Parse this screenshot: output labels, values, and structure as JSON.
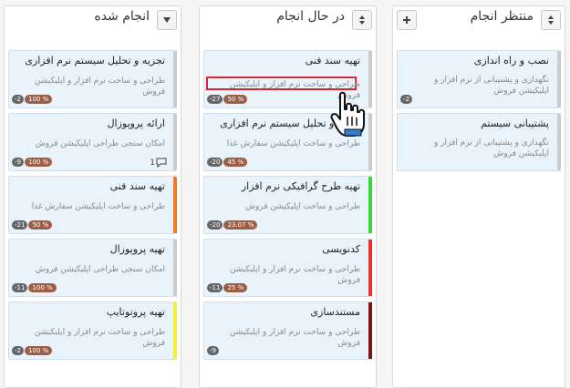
{
  "columns": {
    "done": {
      "title": "انجام شده",
      "header_icon": "filter-icon",
      "cards": [
        {
          "title": "تجزیه و تحلیل سیستم نرم افزاری",
          "subtitle": "طراحی و ساخت نرم افزار و اپلیکیشن فروش",
          "num": "-2",
          "pct": "100 %",
          "color": "#cccccc"
        },
        {
          "title": "ارائه پروپوزال",
          "subtitle": "امکان سنجی طراحی اپلیکیشن فروش",
          "num": "-9",
          "pct": "100 %",
          "comments": "1",
          "color": "#cccccc"
        },
        {
          "title": "تهیه سند فنی",
          "subtitle": "طراحی و ساخت اپلیکیشن سفارش غذا",
          "num": "-21",
          "pct": "50 %",
          "color": "#f07a2a"
        },
        {
          "title": "تهیه پروپوزال",
          "subtitle": "امکان سنجی طراحی اپلیکیشن فروش",
          "num": "-11",
          "pct": "100 %",
          "color": "#cccccc"
        },
        {
          "title": "تهیه پروتوتایپ",
          "subtitle": "طراحی و ساخت نرم افزار و اپلیکیشن فروش",
          "num": "-2",
          "pct": "100 %",
          "color": "#f2f03a"
        }
      ]
    },
    "inprogress": {
      "title": "در حال انجام",
      "header_icon": "sort-icon",
      "cards": [
        {
          "title": "تهیه سند فنی",
          "subtitle": "طراحی و ساخت نرم افزار و اپلیکیشن فروش",
          "num": "-27",
          "pct": "50 %",
          "color": "#cccccc"
        },
        {
          "title": "تجزیه و تحلیل سیستم نرم افزاری",
          "subtitle": "طراحی و ساخت اپلیکیشن سفارش غذا",
          "num": "-20",
          "pct": "45 %",
          "color": "#cccccc"
        },
        {
          "title": "تهیه طرح گرافیکی نرم افزار",
          "subtitle": "طراحی و ساخت اپلیکیشن فروش",
          "num": "-20",
          "pct": "23.07 %",
          "color": "#3ad33a"
        },
        {
          "title": "کدنویسی",
          "subtitle": "طراحی و ساخت نرم افزار و اپلیکیشن فروش",
          "num": "-11",
          "pct": "25 %",
          "color": "#e8322a"
        },
        {
          "title": "مستندسازی",
          "subtitle": "طراحی و ساخت نرم افزار و اپلیکیشن فروش",
          "num": "-9",
          "color": "#7a1616"
        }
      ]
    },
    "waiting": {
      "title": "منتظر انجام",
      "header_icon": "sort-icon",
      "add_icon": "plus-icon",
      "cards": [
        {
          "title": "نصب و راه اندازی",
          "subtitle": "نگهداری و پشتیبانی از نرم افزار و اپلیکیشن فروش",
          "num": "-2",
          "color": "#cccccc"
        },
        {
          "title": "پشتیبانی سیستم",
          "subtitle": "نگهداری و پشتیبانی از نرم افزار و اپلیکیشن فروش",
          "color": "#cccccc"
        }
      ]
    }
  },
  "icons": {
    "comment": "comment-icon",
    "cursor": "hand-pointer-icon"
  },
  "colors": {
    "highlight": "#d9262e",
    "card_bg": "#e8f3fc",
    "badge_num": "#666666",
    "badge_pct": "#9c5f46"
  }
}
